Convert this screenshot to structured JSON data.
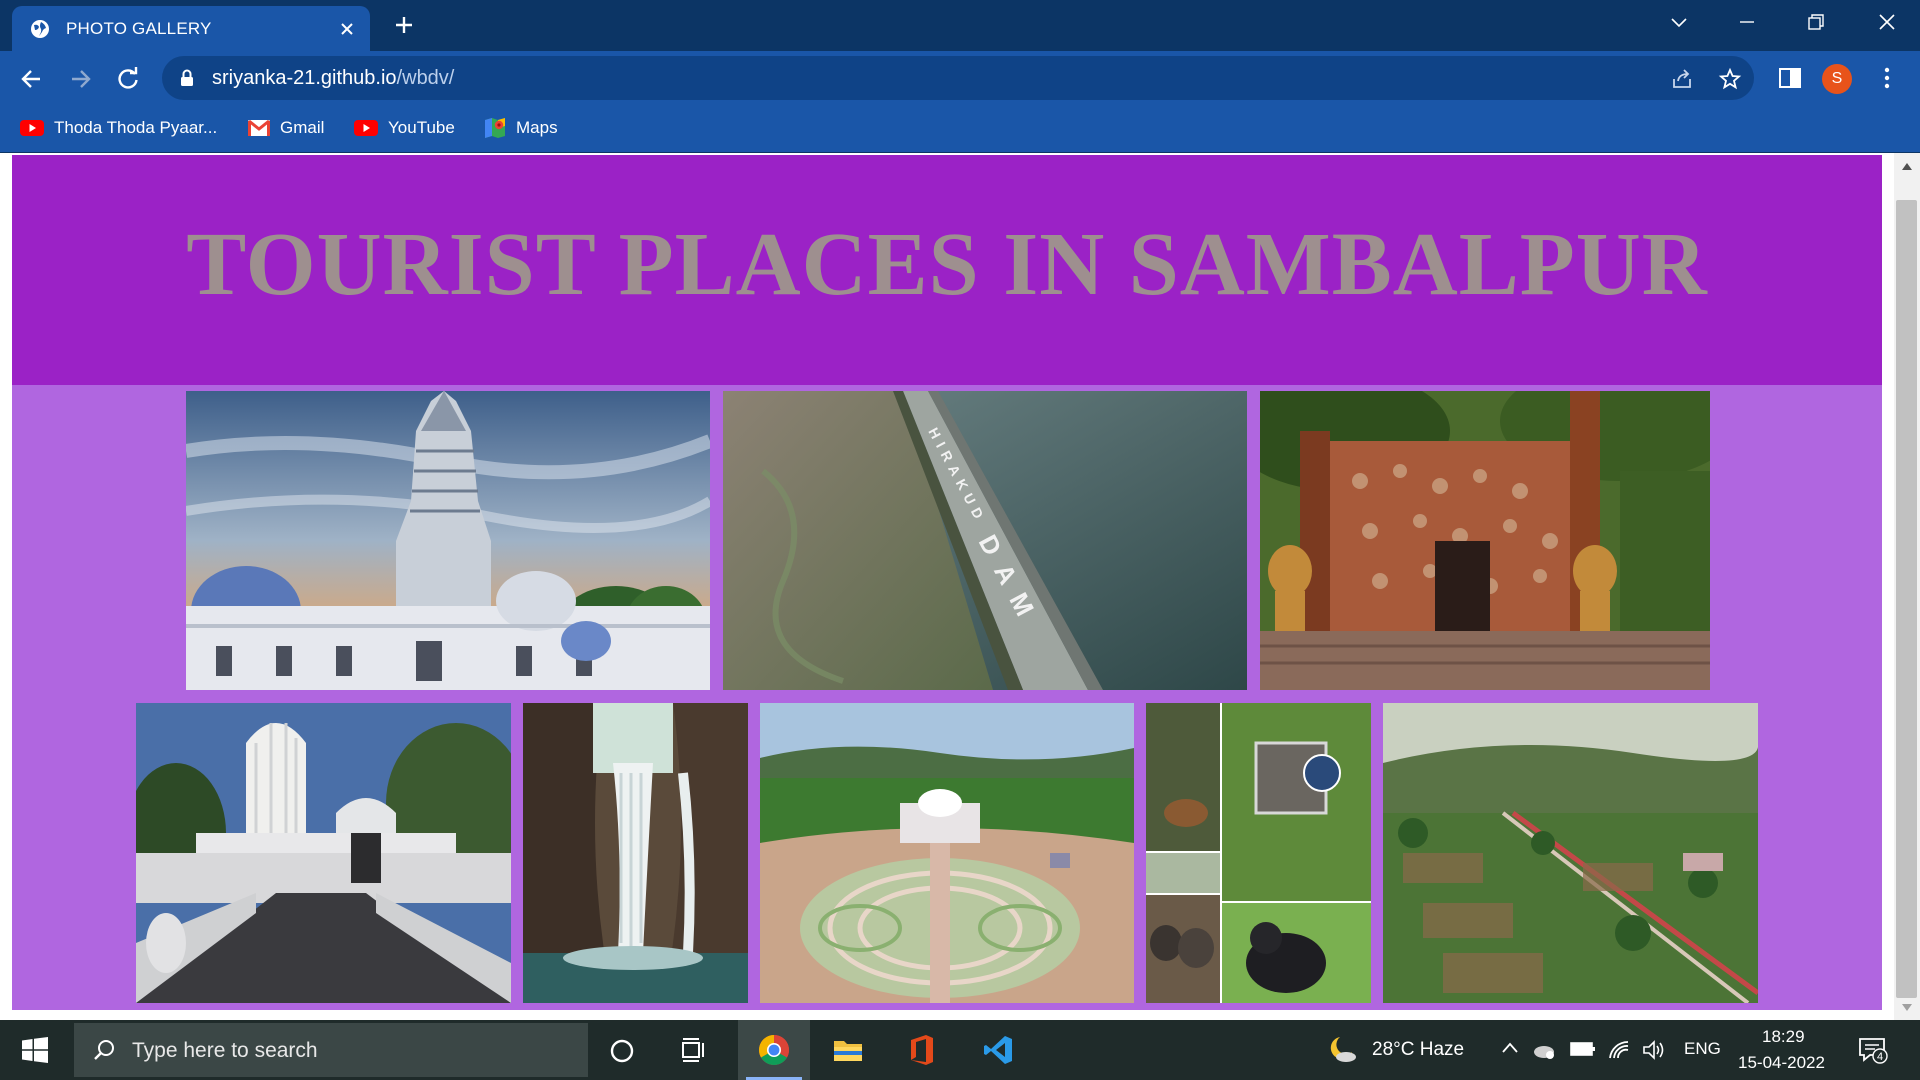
{
  "browser": {
    "tab_title": "PHOTO GALLERY",
    "url_host": "sriyanka-21.github.io",
    "url_path": "/wbdv/",
    "profile_initial": "S",
    "bookmarks": [
      {
        "label": "Thoda Thoda Pyaar...",
        "icon": "youtube-icon"
      },
      {
        "label": "Gmail",
        "icon": "gmail-icon"
      },
      {
        "label": "YouTube",
        "icon": "youtube-icon"
      },
      {
        "label": "Maps",
        "icon": "maps-icon"
      }
    ]
  },
  "page": {
    "title": "TOURIST PLACES IN SAMBALPUR",
    "header_bg": "#9b22c6",
    "gallery_bg": "#b066e0",
    "title_color": "#9e8f8f",
    "photos_row1": [
      "temple-photo",
      "hirakud-dam-photo",
      "shrine-gate-photo"
    ],
    "photos_row2": [
      "white-temple-photo",
      "waterfall-photo",
      "park-aerial-photo",
      "wildlife-collage-photo",
      "garden-aerial-photo"
    ],
    "dam_text": "HIRAKUD DAM"
  },
  "taskbar": {
    "search_placeholder": "Type here to search",
    "weather": "28°C  Haze",
    "language": "ENG",
    "time": "18:29",
    "date": "15-04-2022",
    "notification_count": "4"
  }
}
